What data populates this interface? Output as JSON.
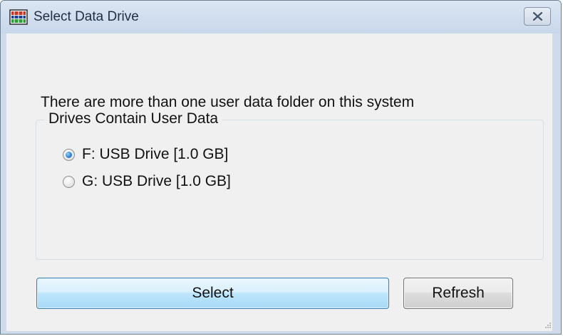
{
  "window": {
    "title": "Select Data Drive",
    "app_icon": "drive-data-icon",
    "close_icon": "close-icon"
  },
  "dialog": {
    "message": "There are more than one user data folder on this system",
    "group_label": "Drives Contain User Data",
    "drives": [
      {
        "label": "F: USB Drive [1.0 GB]",
        "selected": true
      },
      {
        "label": "G: USB Drive [1.0 GB]",
        "selected": false
      }
    ]
  },
  "buttons": {
    "select_label": "Select",
    "refresh_label": "Refresh"
  },
  "colors": {
    "frame": "#cfdbea",
    "client": "#f0f0f0",
    "default_button_border": "#3c7fb1"
  }
}
